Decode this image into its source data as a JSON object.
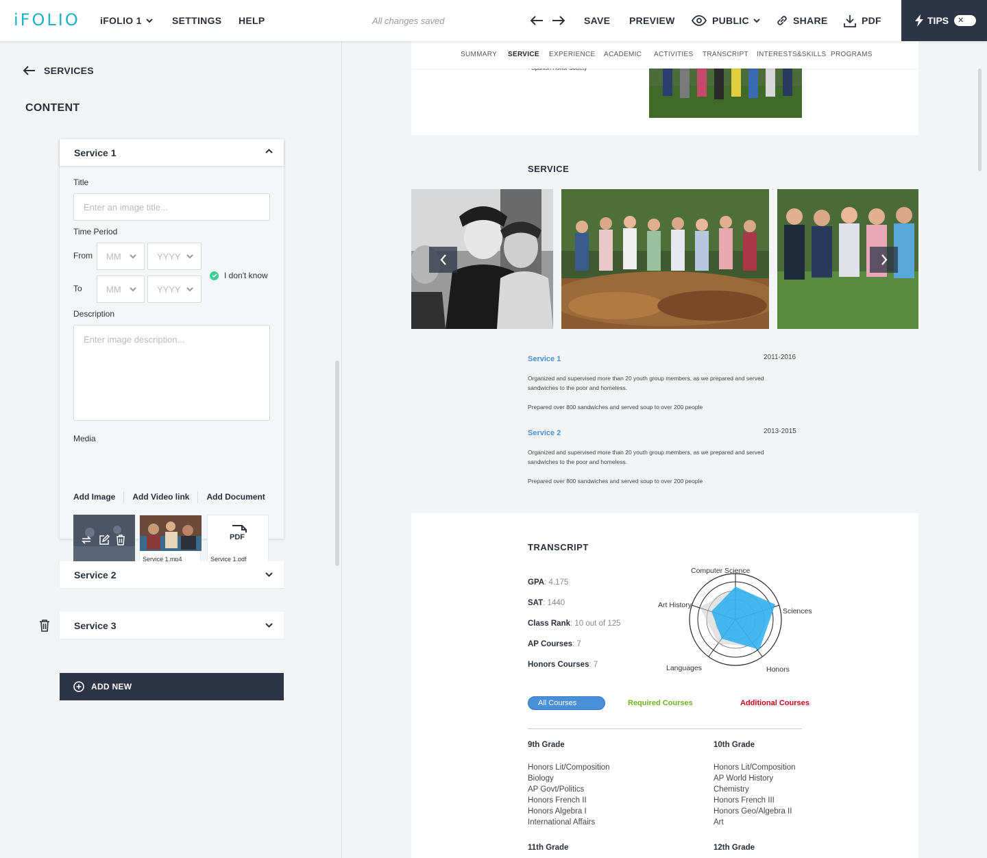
{
  "topbar": {
    "logo": "iFOLIO",
    "portfolio_label": "iFOLIO 1",
    "settings_label": "SETTINGS",
    "help_label": "HELP",
    "status": "All changes saved",
    "save_label": "SAVE",
    "preview_label": "PREVIEW",
    "visibility_label": "PUBLIC",
    "share_label": "SHARE",
    "pdf_label": "PDF",
    "tips_label": "TIPS",
    "tips_toggle_glyph": "✕"
  },
  "left": {
    "back_label": "SERVICES",
    "content_heading": "CONTENT",
    "open_card": {
      "title": "Service 1",
      "title_label": "Title",
      "title_placeholder": "Enter an image title...",
      "time_period_label": "Time Period",
      "from_label": "From",
      "to_label": "To",
      "month_placeholder": "MM",
      "year_placeholder": "YYYY",
      "dont_know_label": "I don't know",
      "description_label": "Description",
      "description_placeholder": "Enter image description...",
      "media_label": "Media",
      "media_actions": [
        "Add Image",
        "Add Video link",
        "Add Document"
      ],
      "media_items": [
        {
          "caption": "",
          "type": "image"
        },
        {
          "caption": "Service 1.mp4",
          "type": "video"
        },
        {
          "caption": "Service 1.pdf",
          "type": "pdf",
          "badge": "PDF"
        }
      ]
    },
    "closed_cards": [
      {
        "title": "Service 2"
      },
      {
        "title": "Service 3"
      }
    ],
    "add_new_label": "ADD NEW"
  },
  "preview": {
    "nav": [
      "SUMMARY",
      "SERVICE",
      "EXPERIENCE",
      "ACADEMIC",
      "ACTIVITIES",
      "TRANSCRIPT",
      "INTERESTS&SKILLS",
      "PROGRAMS"
    ],
    "nav_active": "SERVICE",
    "top_list_item": "• Spanish Honor Society",
    "service_heading": "SERVICE",
    "services": [
      {
        "name": "Service 1",
        "years": "2011-2016",
        "desc1": "Organized and supervised more than 20 youth group members, as we prepared and served sandwiches to the poor and homeless.",
        "desc2": "Prepared over 800 sandwiches and served soup to over 200 people"
      },
      {
        "name": "Service 2",
        "years": "2013-2015",
        "desc1": "Organized and supervised more than 20 youth group members, as we prepared and served sandwiches to the poor and homeless.",
        "desc2": "Prepared over 800 sandwiches and served soup to over 200 people"
      }
    ],
    "transcript_heading": "TRANSCRIPT",
    "stats": [
      {
        "label": "GPA",
        "value": "4.175"
      },
      {
        "label": "SAT",
        "value": "1440"
      },
      {
        "label": "Class Rank",
        "value": "10 out of 125"
      },
      {
        "label": "AP Courses",
        "value": "7"
      },
      {
        "label": "Honors Courses",
        "value": "7"
      }
    ],
    "radar_labels": [
      "Computer Science",
      "Sciences",
      "Honors",
      "Languages",
      "Art History"
    ],
    "filters": {
      "all": "All Courses",
      "required": "Required Courses",
      "additional": "Additional Courses",
      "required_color": "#6cb41c",
      "additional_color": "#d0021b"
    },
    "grades": [
      {
        "title": "9th Grade",
        "courses": [
          "Honors Lit/Composition",
          "Biology",
          "AP Govt/Politics",
          "Honors French II",
          "Honors Algebra I",
          "International Affairs"
        ]
      },
      {
        "title": "10th Grade",
        "courses": [
          "Honors Lit/Composition",
          "AP World History",
          "Chemistry",
          "Honors French III",
          "Honors Geo/Algebra II",
          "Art"
        ]
      },
      {
        "title": "11th Grade",
        "courses": []
      },
      {
        "title": "12th Grade",
        "courses": []
      }
    ]
  },
  "colors": {
    "brand": "#1bb3c9",
    "dark": "#2d3446",
    "link_blue": "#4a90d9",
    "radar_fill": "#29aef0",
    "check_green": "#3ecf8e"
  }
}
